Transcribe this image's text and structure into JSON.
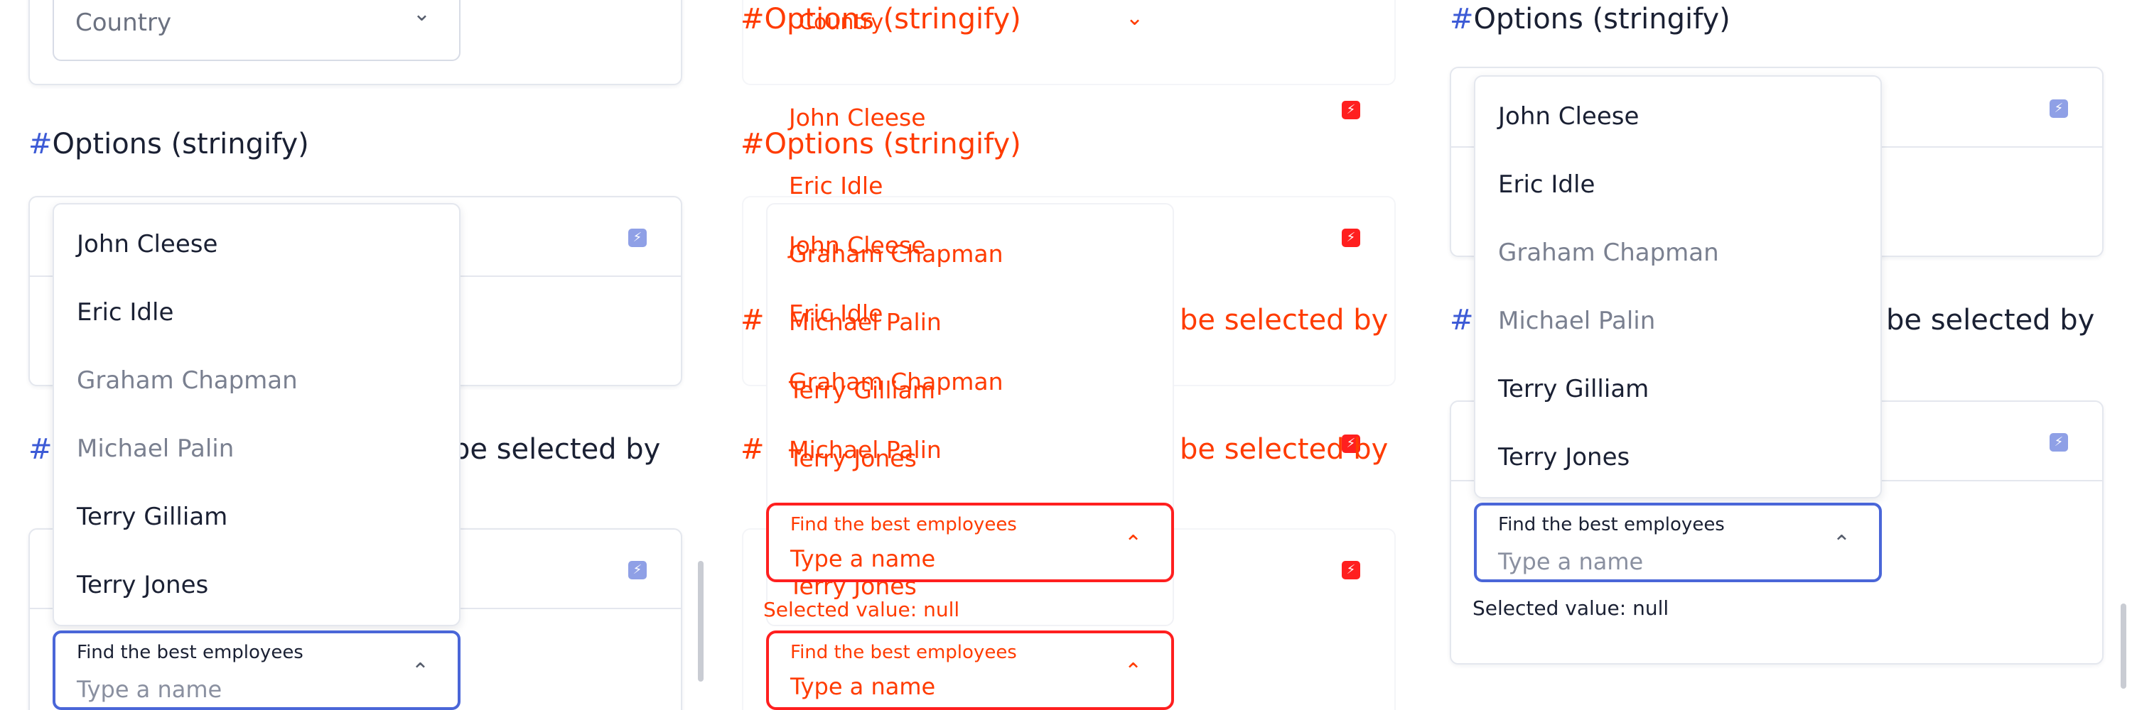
{
  "texts": {
    "country": "Country",
    "options_heading": "Options (stringify)",
    "partial_heading": "be selected by",
    "field_label": "Find the best employees",
    "field_placeholder": "Type a name",
    "selected_value": "Selected value: null",
    "hash": "#"
  },
  "options": [
    {
      "label": "John Cleese",
      "disabled": false
    },
    {
      "label": "Eric Idle",
      "disabled": false
    },
    {
      "label": "Graham Chapman",
      "disabled": true
    },
    {
      "label": "Michael Palin",
      "disabled": true
    },
    {
      "label": "Terry Gilliam",
      "disabled": false
    },
    {
      "label": "Terry Jones",
      "disabled": false
    }
  ],
  "icons": {
    "zap": "⚡",
    "chevron_down": "⌄",
    "chevron_up": "⌃"
  },
  "colors": {
    "accent": "#4a66d8",
    "hash": "#3d5bd6",
    "overlay_red": "#ff1f1f",
    "overlay_orange": "#ff3b00"
  }
}
